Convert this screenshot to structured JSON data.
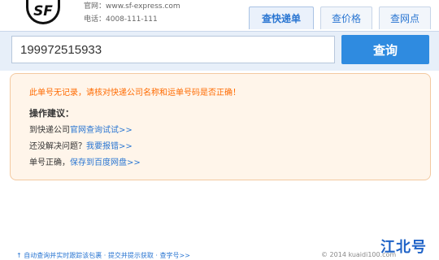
{
  "header": {
    "logo_text": "SF",
    "website_label": "官网：www.sf-express.com",
    "phone_label": "电话：4008-111-111",
    "tabs": [
      {
        "label": "查快递单",
        "active": true
      },
      {
        "label": "查价格",
        "active": false
      },
      {
        "label": "查网点",
        "active": false
      }
    ]
  },
  "search": {
    "value": "199972515933",
    "button_label": "查询"
  },
  "notice": {
    "warning": "此单号无记录，请核对快递公司名称和运单号码是否正确！",
    "tips_title": "操作建议：",
    "line1_prefix": "到快递公司",
    "line1_link": "官网查询试试>>",
    "line2_prefix": "还没解决问题？",
    "line2_link": "我要报错>>",
    "line3_prefix": "单号正确，",
    "line3_link": "保存到百度网盘>>"
  },
  "footer": {
    "left_text": "↑ 自动查询并实时跟踪该包裹 · 提交并提示获取 · 查字号>>",
    "copyright": "© 2014 kuaidi100.com"
  },
  "watermark": "江北号",
  "colors": {
    "accent": "#2f8be0",
    "link": "#2a76d2",
    "warning": "#ff6a00",
    "notice_bg": "#fff5ea"
  }
}
